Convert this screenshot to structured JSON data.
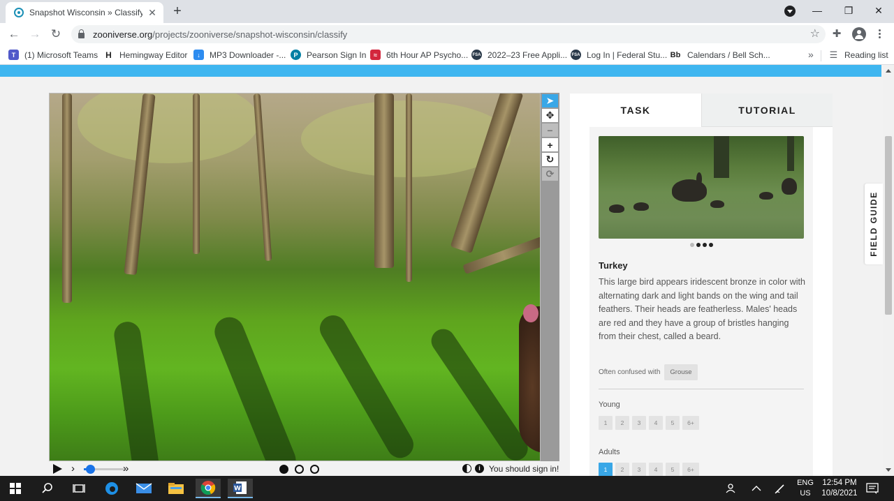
{
  "browser": {
    "tab_title": "Snapshot Wisconsin » Classify —",
    "url_host": "zooniverse.org",
    "url_path": "/projects/zooniverse/snapshot-wisconsin/classify",
    "bookmarks": [
      {
        "label": "(1) Microsoft Teams",
        "icon": "teams-icon",
        "color": "#5059c9"
      },
      {
        "label": "Hemingway Editor",
        "icon": "hemingway-icon",
        "color": "#222222"
      },
      {
        "label": "MP3 Downloader -...",
        "icon": "mp3-icon",
        "color": "#2d8cf0"
      },
      {
        "label": "Pearson Sign In",
        "icon": "pearson-icon",
        "color": "#007fa3"
      },
      {
        "label": "6th Hour AP Psycho...",
        "icon": "psych-icon",
        "color": "#d3273e"
      },
      {
        "label": "2022–23 Free Appli...",
        "icon": "fsa-icon",
        "color": "#2b3a4a"
      },
      {
        "label": "Log In | Federal Stu...",
        "icon": "fsa-icon",
        "color": "#2b3a4a"
      },
      {
        "label": "Calendars / Bell Sch...",
        "icon": "blackboard-icon",
        "color": "#222222"
      }
    ],
    "bookmark_bb": "Bb",
    "bookmark_h": "H",
    "fsa_text": "FSA",
    "reading_list": "Reading list"
  },
  "image_tools": {
    "tools": [
      {
        "name": "select-tool-arrow-icon",
        "glyph": "➤",
        "state": "active"
      },
      {
        "name": "pan-tool-move-icon",
        "glyph": "✥",
        "state": "normal"
      },
      {
        "name": "zoom-out-minus-icon",
        "glyph": "−",
        "state": "disabled"
      },
      {
        "name": "zoom-in-plus-icon",
        "glyph": "+",
        "state": "normal"
      },
      {
        "name": "rotate-icon",
        "glyph": "↻",
        "state": "normal"
      },
      {
        "name": "reset-icon",
        "glyph": "⟳",
        "state": "disabled"
      }
    ]
  },
  "controls": {
    "step_back": "›",
    "step_forward": "»",
    "slider_value": 0.15,
    "frames": 3,
    "current_frame": 1,
    "signin_message": "You should sign in!"
  },
  "task_panel": {
    "tab_task": "TASK",
    "tab_tutorial": "TUTORIAL",
    "carousel": {
      "count": 4,
      "active_index": 0
    },
    "species_name": "Turkey",
    "species_description": "This large bird appears iridescent bronze in color with alternating dark and light bands on the wing and tail feathers. Their heads are featherless. Males' heads are red and they have a group of bristles hanging from their chest, called a beard.",
    "confused_label": "Often confused with",
    "confused_species": "Grouse",
    "young_label": "Young",
    "young_options": [
      "1",
      "2",
      "3",
      "4",
      "5",
      "6+"
    ],
    "adults_label": "Adults",
    "adults_options": [
      "1",
      "2",
      "3",
      "4",
      "5",
      "6+"
    ],
    "adults_selected": 0
  },
  "field_guide_label": "FIELD GUIDE",
  "taskbar": {
    "lang_top": "ENG",
    "lang_bottom": "US",
    "time": "12:54 PM",
    "date": "10/8/2021"
  },
  "colors": {
    "accent_blue": "#3fb6f0",
    "selected_blue": "#39a7e7"
  }
}
